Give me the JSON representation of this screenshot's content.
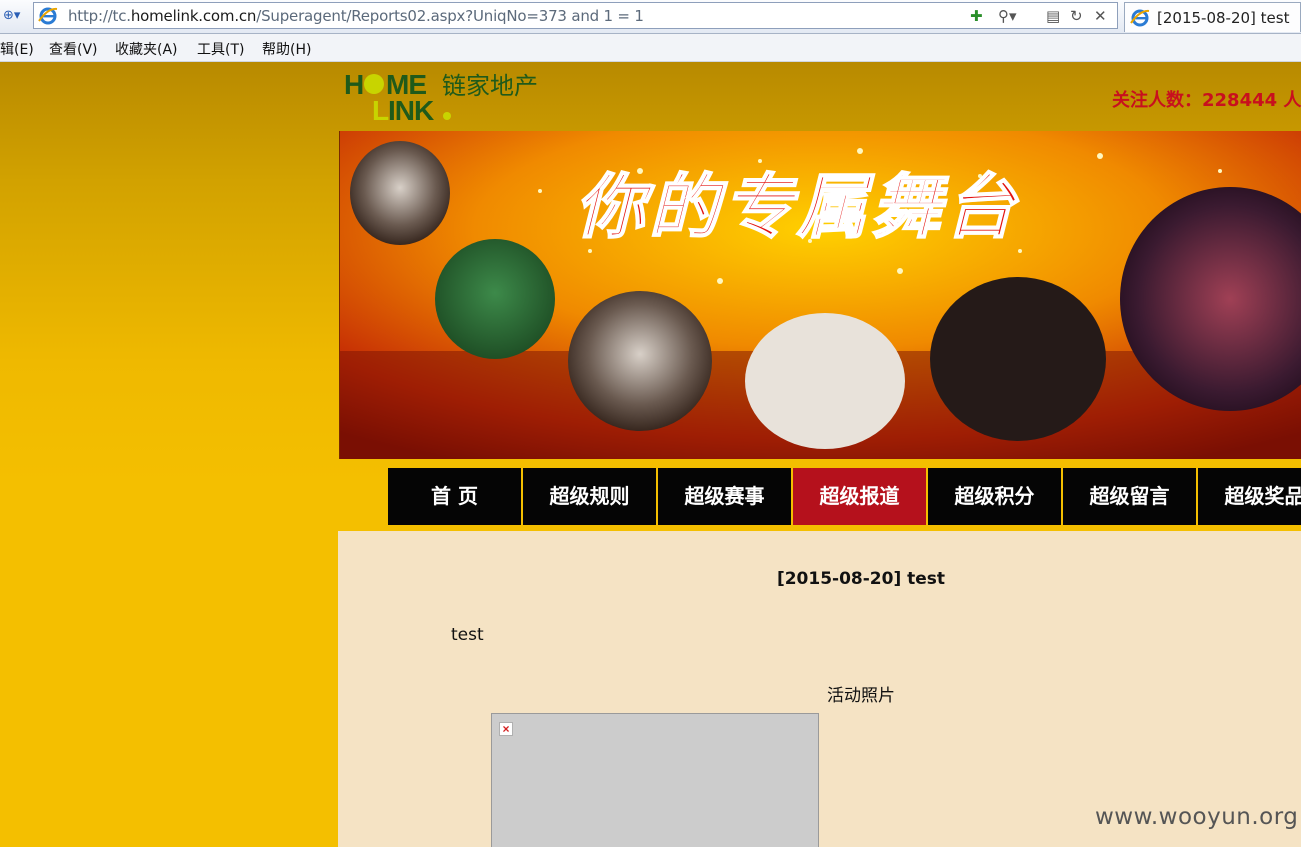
{
  "browser": {
    "url_prefix": "http://tc.",
    "url_domain": "homelink.com.cn",
    "url_path": "/Superagent/Reports02.aspx?UniqNo=373 and 1 = 1",
    "tab_title": "[2015-08-20] test",
    "menu": [
      "辑(E)",
      "查看(V)",
      "收藏夹(A)",
      "工具(T)",
      "帮助(H)"
    ]
  },
  "header": {
    "logo_text": "链家地产",
    "follow_count": "关注人数：228444 人"
  },
  "banner": {
    "slogan": "你的专属舞台"
  },
  "nav": {
    "items": [
      "首 页",
      "超级规则",
      "超级赛事",
      "超级报道",
      "超级积分",
      "超级留言",
      "超级奖品"
    ],
    "active_index": 3
  },
  "article": {
    "title": "[2015-08-20] test",
    "body": "test",
    "photo_caption": "活动照片"
  },
  "watermark": "www.wooyun.org",
  "colors": {
    "page_yellow": "#f4bf00",
    "nav_black": "#050505",
    "nav_active_red": "#b5111c",
    "content_beige": "#f5e3c4",
    "follow_red": "#c8101e",
    "logo_green": "#1f5a1a",
    "logo_lime": "#c8d400"
  }
}
